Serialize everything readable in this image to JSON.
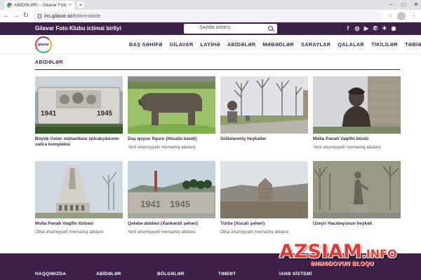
{
  "browser": {
    "tab_title": "ABİDƏLƏR – Gilavar Foto Klubu",
    "tab_close": "×",
    "new_tab": "+",
    "url_host": "ins.gilavar.az",
    "url_path": "/bolme/abide"
  },
  "site": {
    "title": "Gilavar Foto Klubu ictimai birliyi",
    "search_placeholder": "Saytda axtarış",
    "logo_text": "gilavar",
    "socials": [
      "f",
      "◎",
      "▶",
      "✆",
      "✈",
      "◉"
    ]
  },
  "nav": [
    "BAŞ SƏHİFƏ",
    "GİLAVAR",
    "LAYİHƏ",
    "ABİDƏLƏR",
    "MƏBƏDLƏR",
    "SARAYLAR",
    "QALALAR",
    "TİKİLİLƏR",
    "TƏBİƏT"
  ],
  "section": {
    "title": "ABİDƏLƏR"
  },
  "cards": [
    {
      "title": "Böyük Vətən müharibəsi iştirakçılarının xatirə kompleksi",
      "sub": ""
    },
    {
      "title": "Daş qoyun fiquru (Hüsülü kəndi)",
      "sub": "Yerli əhəmiyyətli memarlıq abidəsi"
    },
    {
      "title": "Güllələnmiş heykəllər",
      "sub": ""
    },
    {
      "title": "Molla Pənah Vaqifin büstü",
      "sub": "Yerli əhəmiyyətli memarlıq abidəsi"
    },
    {
      "title": "Molla Pənah Vaqifin türbəsi",
      "sub": "Ölkə əhəmiyyətli memarlıq abidəsi"
    },
    {
      "title": "Qələbə abidəsi (Xankəndi şəhəri)",
      "sub": "Yerli əhəmiyyətli memarlıq abidəsi"
    },
    {
      "title": "Türbə (Xocalı şəhəri)",
      "sub": "Ölkə əhəmiyyətli memarlıq abidəsi"
    },
    {
      "title": "Üzeyir Hacıbəyovun heykəli",
      "sub": ""
    }
  ],
  "image_text": {
    "year_left": "1941",
    "year_right": "1945"
  },
  "footer": [
    "HAQQIMIZDA",
    "ABİDƏLƏR",
    "BÖLGƏLƏR",
    "TƏBİƏT",
    "İANƏ SİSTEMİ"
  ],
  "watermark": {
    "brand": "AZSIAM",
    "tld": ".INFO",
    "tagline": "ƏHMƏDOVUN BLOQU"
  },
  "colors": {
    "brand_purple": "#3d1f47",
    "watermark_red": "#e53935"
  }
}
